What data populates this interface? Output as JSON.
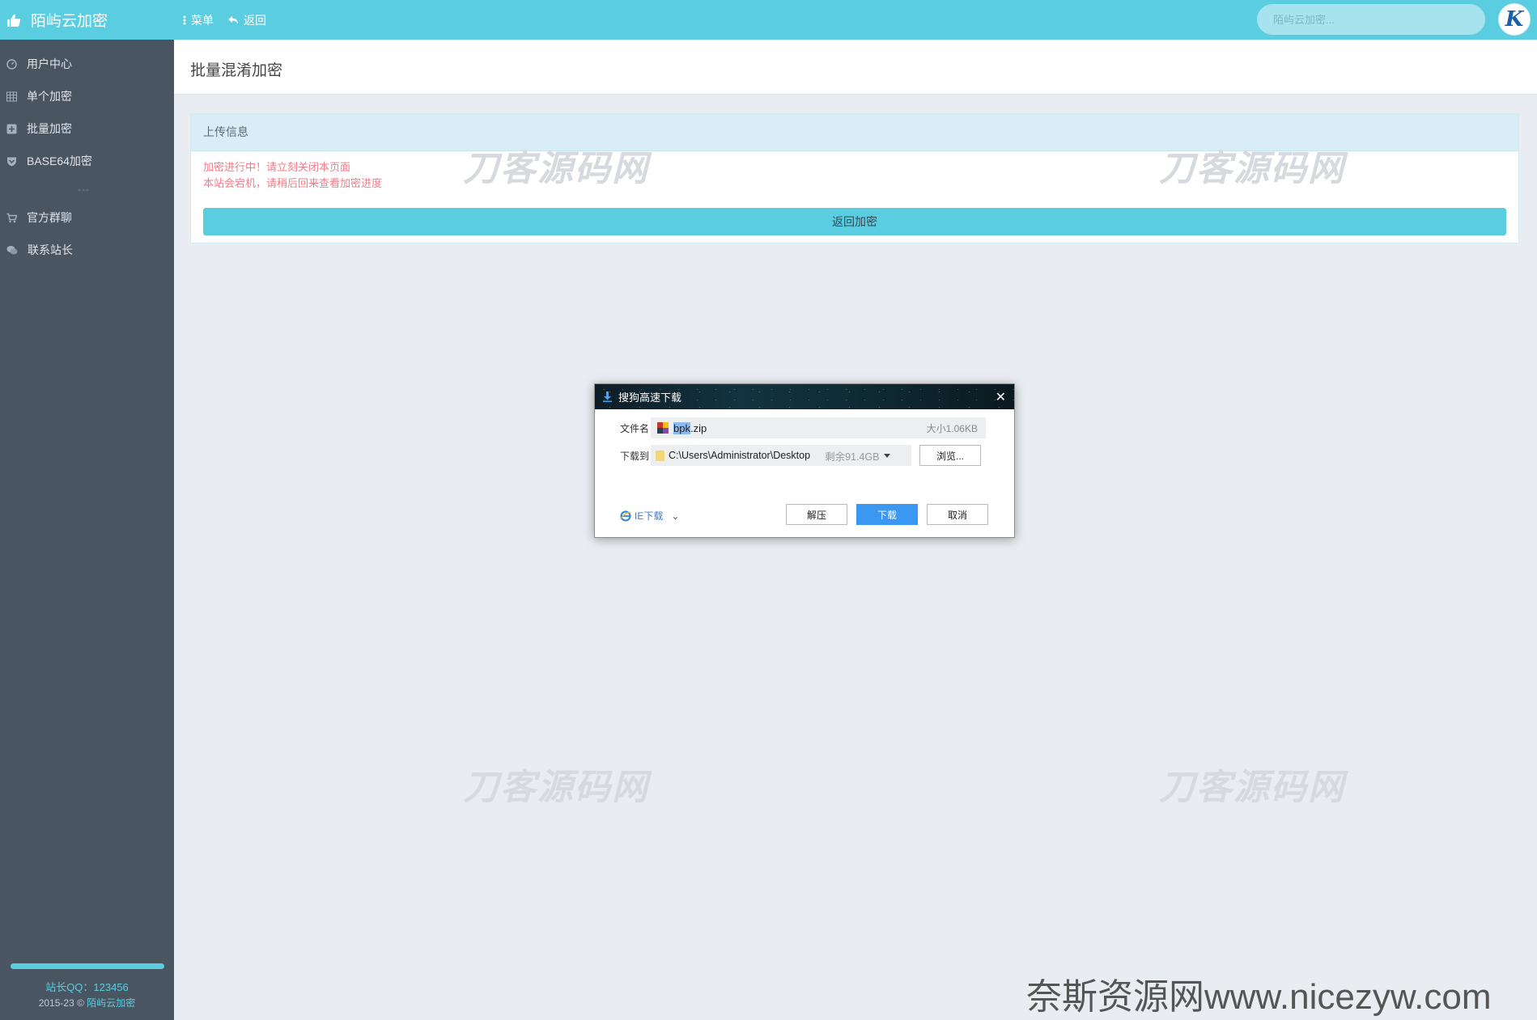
{
  "topbar": {
    "brand": "陌屿云加密",
    "nav": [
      {
        "label": "菜单"
      },
      {
        "label": "返回"
      }
    ],
    "search_placeholder": "陌屿云加密..."
  },
  "sidebar": {
    "items": [
      {
        "label": "用户中心",
        "icon": "dashboard-icon"
      },
      {
        "label": "单个加密",
        "icon": "grid-icon"
      },
      {
        "label": "批量加密",
        "icon": "plus-square-icon"
      },
      {
        "label": "BASE64加密",
        "icon": "shield-icon"
      }
    ],
    "separator": "---",
    "items2": [
      {
        "label": "官方群聊",
        "icon": "cart-icon"
      },
      {
        "label": "联系站长",
        "icon": "chat-icon"
      }
    ],
    "footer": {
      "qq": "站长QQ：123456",
      "copyright_prefix": "2015-23 ©",
      "copyright_link": "陌屿云加密"
    }
  },
  "page": {
    "title": "批量混淆加密",
    "panel": {
      "heading": "上传信息",
      "line1": "加密进行中！请立刻关闭本页面",
      "line2": "本站会宕机，请稍后回来查看加密进度",
      "back_button": "返回加密"
    }
  },
  "watermarks": {
    "text": "刀客源码网",
    "corner": "奈斯资源网www.nicezyw.com"
  },
  "dialog": {
    "title": "搜狗高速下载",
    "filename_label": "文件名",
    "filename_selected": "bpk",
    "filename_rest": ".zip",
    "size": "大小1.06KB",
    "saveto_label": "下载到",
    "path": "C:\\Users\\Administrator\\Desktop",
    "remaining": "剩余91.4GB",
    "browse": "浏览...",
    "ie_download": "IE下载",
    "unzip": "解压",
    "download": "下载",
    "cancel": "取消"
  },
  "colors": {
    "accent": "#5bcde0",
    "sidebar": "#4a5562",
    "warning_text": "#f07b8a",
    "download_button": "#3a98f2"
  }
}
